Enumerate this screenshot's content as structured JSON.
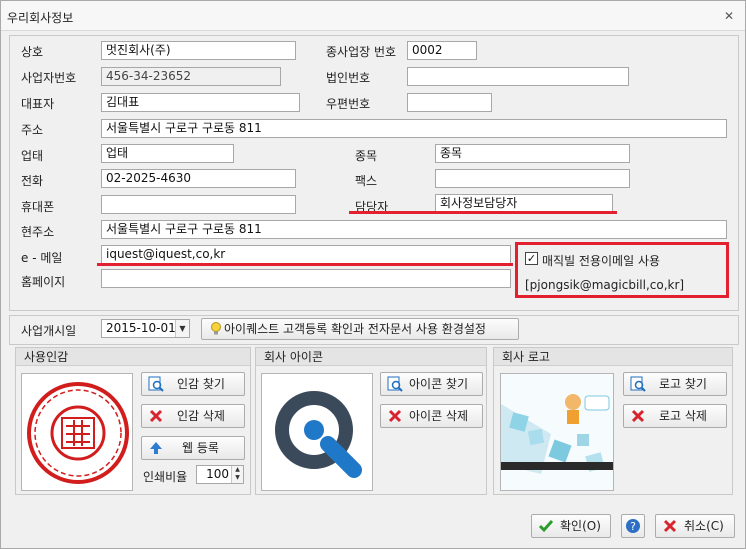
{
  "window": {
    "title": "우리회사정보"
  },
  "colors": {
    "highlight": "#e2202f",
    "accent_blue": "#1f6fbf",
    "confirm_green": "#2e9b2e",
    "delete_red": "#d8242f",
    "seal_red": "#d21d1d"
  },
  "icons": {
    "close": "close-icon",
    "confirm": "check-icon",
    "help": "help-icon",
    "cancel": "cancel-icon",
    "find": "search-image-icon",
    "delete": "delete-icon",
    "upload": "upload-arrow-icon",
    "bulb": "lightbulb-icon"
  },
  "form": {
    "company_name": {
      "label": "상호",
      "value": "멋진회사(주)"
    },
    "branch_no": {
      "label": "종사업장 번호",
      "value": "0002"
    },
    "biz_reg_no": {
      "label": "사업자번호",
      "value": "456-34-23652"
    },
    "corp_reg_no": {
      "label": "법인번호",
      "value": ""
    },
    "ceo": {
      "label": "대표자",
      "value": "김대표"
    },
    "zip": {
      "label": "우편번호",
      "value": ""
    },
    "address": {
      "label": "주소",
      "value": "서울특별시 구로구 구로동 811"
    },
    "biz_type": {
      "label": "업태",
      "value": "업태"
    },
    "biz_item": {
      "label": "종목",
      "value": "종목"
    },
    "phone": {
      "label": "전화",
      "value": "02-2025-4630"
    },
    "fax": {
      "label": "팩스",
      "value": ""
    },
    "mobile": {
      "label": "휴대폰",
      "value": ""
    },
    "manager": {
      "label": "담당자",
      "value": "회사정보담당자"
    },
    "current_address": {
      "label": "현주소",
      "value": "서울특별시 구로구 구로동 811"
    },
    "email": {
      "label": "e - 메일",
      "value": "iquest@iquest,co,kr"
    },
    "homepage": {
      "label": "홈페이지",
      "value": ""
    },
    "use_dedicated_email": {
      "label": "매직빌 전용이메일 사용",
      "checked": true,
      "mark": "✓",
      "address": "[pjongsik@magicbill,co,kr]"
    }
  },
  "business_start": {
    "label": "사업개시일",
    "value": "2015-10-01",
    "settings_button": "아이퀘스트 고객등록 확인과 전자문서 사용 환경설정"
  },
  "seal": {
    "title": "사용인감",
    "find_button": "인감 찾기",
    "delete_button": "인감 삭제",
    "web_register_button": "웹 등록",
    "print_ratio_label": "인쇄비율",
    "print_ratio_value": "100"
  },
  "icon_panel": {
    "title": "회사 아이콘",
    "find_button": "아이콘 찾기",
    "delete_button": "아이콘 삭제"
  },
  "logo_panel": {
    "title": "회사 로고",
    "find_button": "로고 찾기",
    "delete_button": "로고 삭제"
  },
  "footer": {
    "confirm_button": "확인(O)",
    "cancel_button": "취소(C)"
  }
}
